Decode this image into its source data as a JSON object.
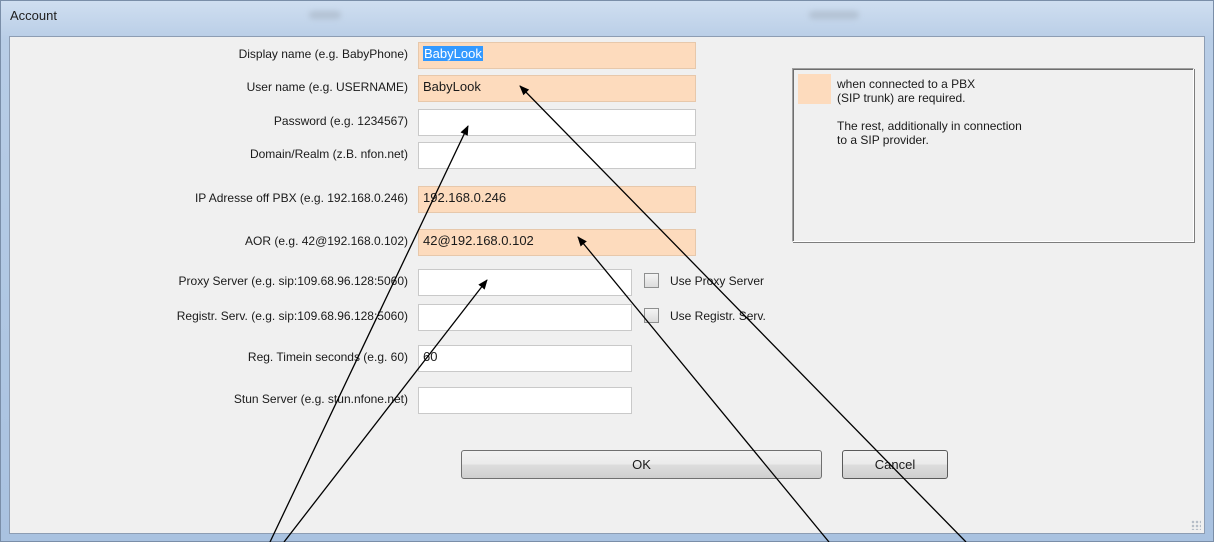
{
  "window": {
    "title": "Account"
  },
  "fields": [
    {
      "label": "Display name  (e.g. BabyPhone)",
      "value": "BabyLook",
      "selected": true,
      "required": true
    },
    {
      "label": "User name (e.g. USERNAME)",
      "value": "BabyLook",
      "required": true
    },
    {
      "label": "Password (e.g. 1234567)",
      "value": ""
    },
    {
      "label": "Domain/Realm (z.B. nfon.net)",
      "value": ""
    },
    {
      "label": "IP Adresse off PBX (e.g. 192.168.0.246)",
      "value": "192.168.0.246",
      "required": true
    },
    {
      "label": "AOR (e.g. 42@192.168.0.102)",
      "value": "42@192.168.0.102",
      "required": true
    },
    {
      "label": "Proxy Server (e.g.  sip:109.68.96.128:5060)",
      "value": "",
      "checkbox": "Use Proxy Server"
    },
    {
      "label": "Registr. Serv. (e.g.  sip:109.68.96.128:5060)",
      "value": "",
      "checkbox": "Use Registr. Serv."
    },
    {
      "label": "Reg. Timein seconds (e.g. 60)",
      "value": "60"
    },
    {
      "label": "Stun Server (e.g. stun.nfone.net)",
      "value": ""
    }
  ],
  "info": {
    "line1": "when connected to a PBX",
    "line2": "(SIP trunk) are required.",
    "line3": "The rest, additionally in connection",
    "line4": "to a SIP provider."
  },
  "buttons": {
    "ok": "OK",
    "cancel": "Cancel"
  },
  "colors": {
    "required_bg": "#fddbbd",
    "selection": "#3399ff"
  }
}
